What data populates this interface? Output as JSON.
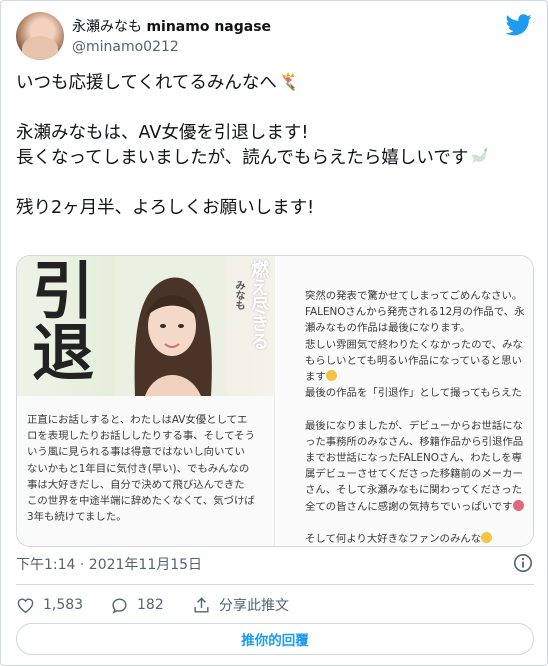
{
  "author": {
    "display_name": "永瀬みなも",
    "display_name_latin": "minamo nagase",
    "handle": "@minamo0212",
    "avatar_icon": "avatar",
    "logo_icon": "twitter-bird-icon",
    "brand_color": "#1d9bf0"
  },
  "tweet": {
    "line1": "いつも応援してくれてるみんなへ",
    "line2": "永瀬みなもは、AV女優を引退します!",
    "line3": "長くなってしまいましたが、読んでもらえたら嬉しいです",
    "line4": "残り2ヶ月半、よろしくお願いします!",
    "emoji1": "bouquet-icon",
    "emoji2": "dove-icon"
  },
  "media": {
    "poster_title": "引退",
    "poster_side_main": "燃え尽きる",
    "poster_side_sub": "みなも",
    "letter_left": [
      "正直にお話しすると、わたしはAV女優としてエ",
      "ロを表現したりお話ししたりする事、そしてそう",
      "いう風に見られる事は得意ではないし向いてい",
      "ないかもと1年目に気付き(早い)、でもみんなの",
      "事は大好きだし、自分で決めて飛び込んできた",
      "この世界を中途半端に辞めたくなくて、気づけば",
      "3年も続けてました。"
    ],
    "letter_right": [
      "突然の発表で驚かせてしまってごめんなさい。",
      "FALENOさんから発売される12月の作品で、永",
      "瀬みなもの作品は最後になります。",
      "悲しい雰囲気で終わりたくなかったので、みな",
      "もらしいとても明るい作品になっていると思い",
      "ます",
      "最後の作品を「引退作」として撮ってもらえた",
      "",
      "最後になりましたが、デビューからお世話にな",
      "った事務所のみなさん、移籍作品から引退作品",
      "までお世話になったFALENOさん、わたしを専",
      "属デビューさせてくださった移籍前のメーカー",
      "さん、そして永瀬みなもに関わってくださった",
      "全ての皆さんに感謝の気持ちでいっぱいです",
      "",
      "そして何より大好きなファンのみんな"
    ]
  },
  "meta": {
    "timestamp": "下午1:14 · 2021年11月15日"
  },
  "actions": {
    "like_count": "1,583",
    "reply_count": "182",
    "share_label": "分享此推文",
    "reply_button": "推你的回覆",
    "like_color": "#536471"
  }
}
